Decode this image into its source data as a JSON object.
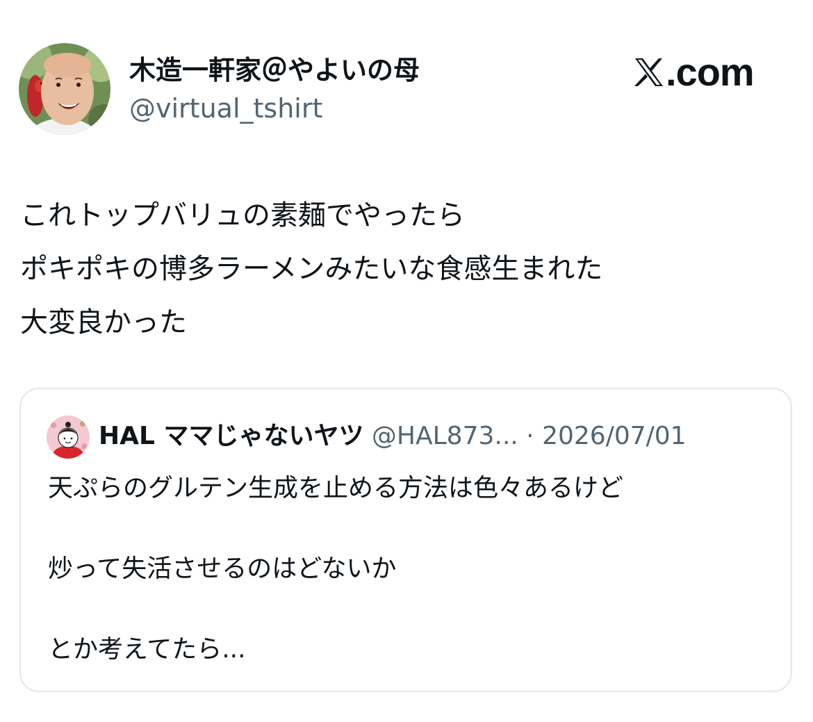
{
  "author": {
    "display_name": "木造一軒家＠やよいの母",
    "handle": "@virtual_tshirt"
  },
  "brand": {
    "text": ".com",
    "logo_icon": "x-logo-icon"
  },
  "tweet": {
    "lines": [
      "これトップバリュの素麺でやったら",
      "ポキポキの博多ラーメンみたいな食感生まれた",
      "大変良かった"
    ]
  },
  "quoted_tweet": {
    "display_name": "HAL ママじゃないヤツ",
    "handle": "@HAL873...",
    "separator": "·",
    "date": "2026/07/01",
    "lines": [
      "天ぷらのグルテン生成を止める方法は色々あるけど",
      "",
      "炒って失活させるのはどないか",
      "",
      "とか考えてたら..."
    ]
  },
  "colors": {
    "text_primary": "#0f1419",
    "text_secondary": "#536471",
    "card_border": "#e1e8ed"
  }
}
